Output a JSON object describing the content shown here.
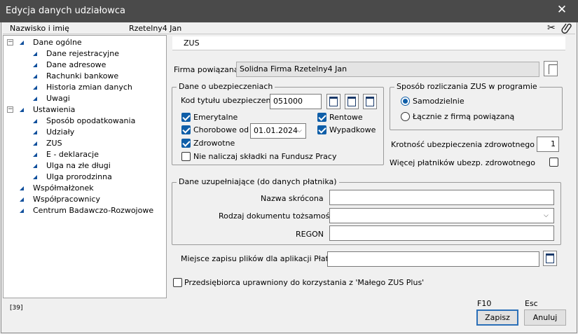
{
  "window": {
    "title": "Edycja danych udziałowca",
    "close_label": "✕"
  },
  "header": {
    "name_label": "Nazwisko i imię",
    "name_value": "Rzetelny4 Jan",
    "scissors_icon": "✂",
    "clip_icon": "📎"
  },
  "tree": {
    "items": [
      {
        "label": "Dane ogólne",
        "level": 0,
        "expander": "−"
      },
      {
        "label": "Dane rejestracyjne",
        "level": 1
      },
      {
        "label": "Dane adresowe",
        "level": 1
      },
      {
        "label": "Rachunki bankowe",
        "level": 1
      },
      {
        "label": "Historia zmian danych",
        "level": 1
      },
      {
        "label": "Uwagi",
        "level": 1
      },
      {
        "label": "Ustawienia",
        "level": 0,
        "expander": "−"
      },
      {
        "label": "Sposób opodatkowania",
        "level": 1
      },
      {
        "label": "Udziały",
        "level": 1
      },
      {
        "label": "ZUS",
        "level": 1
      },
      {
        "label": "E - deklaracje",
        "level": 1
      },
      {
        "label": "Ulga na złe długi",
        "level": 1
      },
      {
        "label": "Ulga prorodzinna",
        "level": 1
      },
      {
        "label": "Współmałżonek",
        "level": 0
      },
      {
        "label": "Współpracownicy",
        "level": 0
      },
      {
        "label": "Centrum Badawczo-Rozwojowe",
        "level": 0
      }
    ]
  },
  "zus": {
    "section_title": "ZUS",
    "firma_label": "Firma powiązana",
    "firma_value": "Solidna Firma Rzetelny4 Jan",
    "insurance": {
      "legend": "Dane o ubezpieczeniach",
      "kod_label": "Kod tytułu ubezpieczenia",
      "kod_value": "051000",
      "emerytalne": "Emerytalne",
      "rentowe": "Rentowe",
      "chorobowe": "Chorobowe od",
      "chorobowe_date": "01.01.2024",
      "wypadkowe": "Wypadkowe",
      "zdrowotne": "Zdrowotne",
      "fp": "Nie naliczaj składki na Fundusz Pracy"
    },
    "settlement": {
      "legend": "Sposób rozliczania ZUS w programie",
      "opt1": "Samodzielnie",
      "opt2": "Łącznie z firmą powiązaną"
    },
    "krotnosc_label": "Krotność ubezpieczenia zdrowotnego",
    "krotnosc_value": "1",
    "wiecej_label": "Więcej płatników ubezp. zdrowotnego",
    "extra": {
      "legend": "Dane uzupełniające (do danych płatnika)",
      "nazwa_label": "Nazwa skrócona",
      "nazwa_value": "",
      "rodzaj_label": "Rodzaj dokumentu tożsamości",
      "rodzaj_value": "",
      "regon_label": "REGON",
      "regon_value": ""
    },
    "miejsce_label": "Miejsce zapisu plików dla aplikacji Płatnik",
    "miejsce_value": "",
    "maly_zus_label": "Przedsiębiorca uprawniony do korzystania z 'Małego ZUS Plus'"
  },
  "footer": {
    "code": "[39]",
    "save_key": "F10",
    "cancel_key": "Esc",
    "save_label": "Zapisz",
    "cancel_label": "Anuluj"
  }
}
